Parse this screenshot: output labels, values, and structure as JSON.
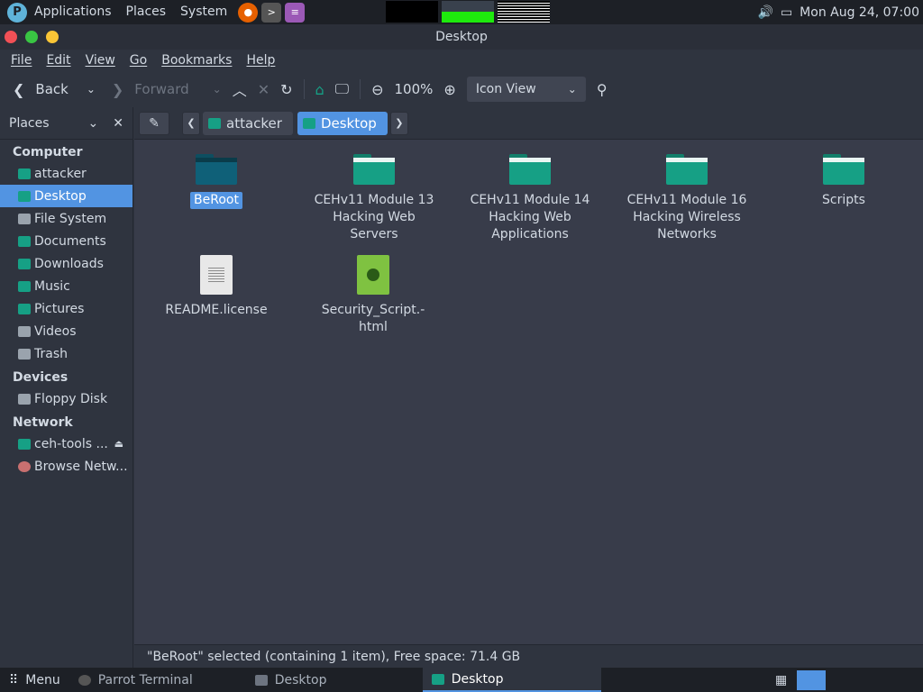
{
  "top_panel": {
    "menus": [
      "Applications",
      "Places",
      "System"
    ],
    "clock": "Mon Aug 24, 07:00"
  },
  "window": {
    "title": "Desktop"
  },
  "menubar": [
    "File",
    "Edit",
    "View",
    "Go",
    "Bookmarks",
    "Help"
  ],
  "toolbar": {
    "back": "Back",
    "forward": "Forward",
    "zoom": "100%",
    "view_mode": "Icon View"
  },
  "sidebar": {
    "header": "Places",
    "sections": [
      {
        "title": "Computer",
        "items": [
          "attacker",
          "Desktop",
          "File System",
          "Documents",
          "Downloads",
          "Music",
          "Pictures",
          "Videos",
          "Trash"
        ]
      },
      {
        "title": "Devices",
        "items": [
          "Floppy Disk"
        ]
      },
      {
        "title": "Network",
        "items": [
          "ceh-tools ...",
          "Browse Netw..."
        ]
      }
    ],
    "selected": "Desktop"
  },
  "breadcrumb": [
    "attacker",
    "Desktop"
  ],
  "files": [
    {
      "name": "BeRoot",
      "type": "folder",
      "selected": true
    },
    {
      "name": "CEHv11 Module 13 Hacking Web Servers",
      "type": "folder"
    },
    {
      "name": "CEHv11 Module 14 Hacking Web Applications",
      "type": "folder"
    },
    {
      "name": "CEHv11 Module 16 Hacking Wireless Networks",
      "type": "folder"
    },
    {
      "name": "Scripts",
      "type": "folder"
    },
    {
      "name": "README.license",
      "type": "text"
    },
    {
      "name": "Security_Script.-html",
      "type": "html"
    }
  ],
  "status": "\"BeRoot\" selected (containing 1 item), Free space: 71.4 GB",
  "taskbar": {
    "menu": "Menu",
    "tasks": [
      "Parrot Terminal",
      "Desktop",
      "Desktop"
    ]
  },
  "colors": {
    "accent": "#5294e2",
    "folder": "#16a085",
    "panel": "#1d2026",
    "content_bg": "#383c4a"
  }
}
